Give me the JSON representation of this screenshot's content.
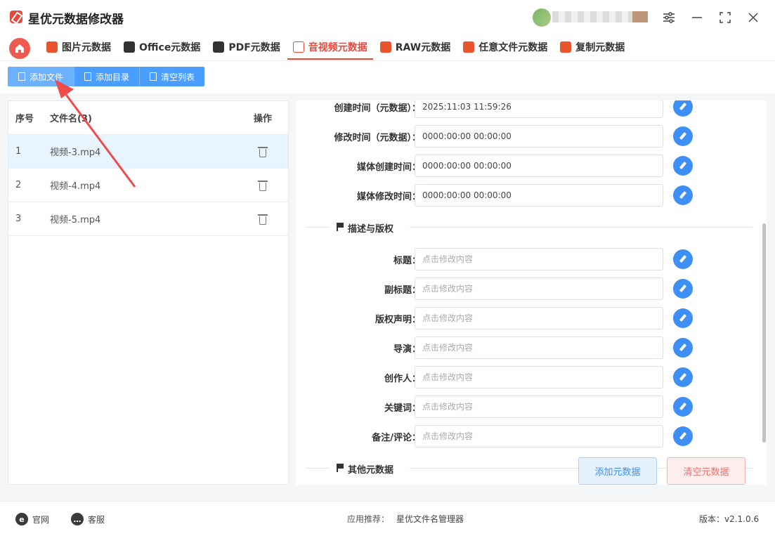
{
  "app": {
    "title": "星优元数据修改器"
  },
  "tabs": [
    {
      "label": "图片元数据",
      "icon": "image-icon",
      "color": "#e8552d"
    },
    {
      "label": "Office元数据",
      "icon": "office-icon",
      "color": "#333333"
    },
    {
      "label": "PDF元数据",
      "icon": "pdf-icon",
      "color": "#333333"
    },
    {
      "label": "音视频元数据",
      "icon": "video-icon",
      "color": "#e8473c",
      "active": true
    },
    {
      "label": "RAW元数据",
      "icon": "raw-icon",
      "color": "#e8552d"
    },
    {
      "label": "任意文件元数据",
      "icon": "any-file-icon",
      "color": "#e8552d"
    },
    {
      "label": "复制元数据",
      "icon": "copy-icon",
      "color": "#e8552d"
    }
  ],
  "toolbar": {
    "add_file": "添加文件",
    "add_dir": "添加目录",
    "clear_list": "清空列表"
  },
  "file_table": {
    "headers": {
      "no": "序号",
      "name": "文件名(3)",
      "op": "操作"
    },
    "rows": [
      {
        "no": "1",
        "name": "视频-3.mp4"
      },
      {
        "no": "2",
        "name": "视频-4.mp4"
      },
      {
        "no": "3",
        "name": "视频-5.mp4"
      }
    ]
  },
  "meta": {
    "time_fields": [
      {
        "label": "创建时间（元数据）：",
        "value": "2025:11:03 11:59:26"
      },
      {
        "label": "修改时间（元数据）：",
        "value": "0000:00:00 00:00:00"
      },
      {
        "label": "媒体创建时间：",
        "value": "0000:00:00 00:00:00"
      },
      {
        "label": "媒体修改时间：",
        "value": "0000:00:00 00:00:00"
      }
    ],
    "section_desc": "描述与版权",
    "desc_fields": [
      {
        "label": "标题：",
        "placeholder": "点击修改内容"
      },
      {
        "label": "副标题：",
        "placeholder": "点击修改内容"
      },
      {
        "label": "版权声明：",
        "placeholder": "点击修改内容"
      },
      {
        "label": "导演：",
        "placeholder": "点击修改内容"
      },
      {
        "label": "创作人：",
        "placeholder": "点击修改内容"
      },
      {
        "label": "关键词：",
        "placeholder": "点击修改内容"
      },
      {
        "label": "备注/评论：",
        "placeholder": "点击修改内容"
      }
    ],
    "section_other": "其他元数据",
    "add_meta": "添加元数据",
    "clear_meta": "清空元数据"
  },
  "footer": {
    "website": "官网",
    "service": "客服",
    "recommend_label": "应用推荐：",
    "recommend_app": "星优文件名管理器",
    "version": "版本：v2.1.0.6"
  }
}
